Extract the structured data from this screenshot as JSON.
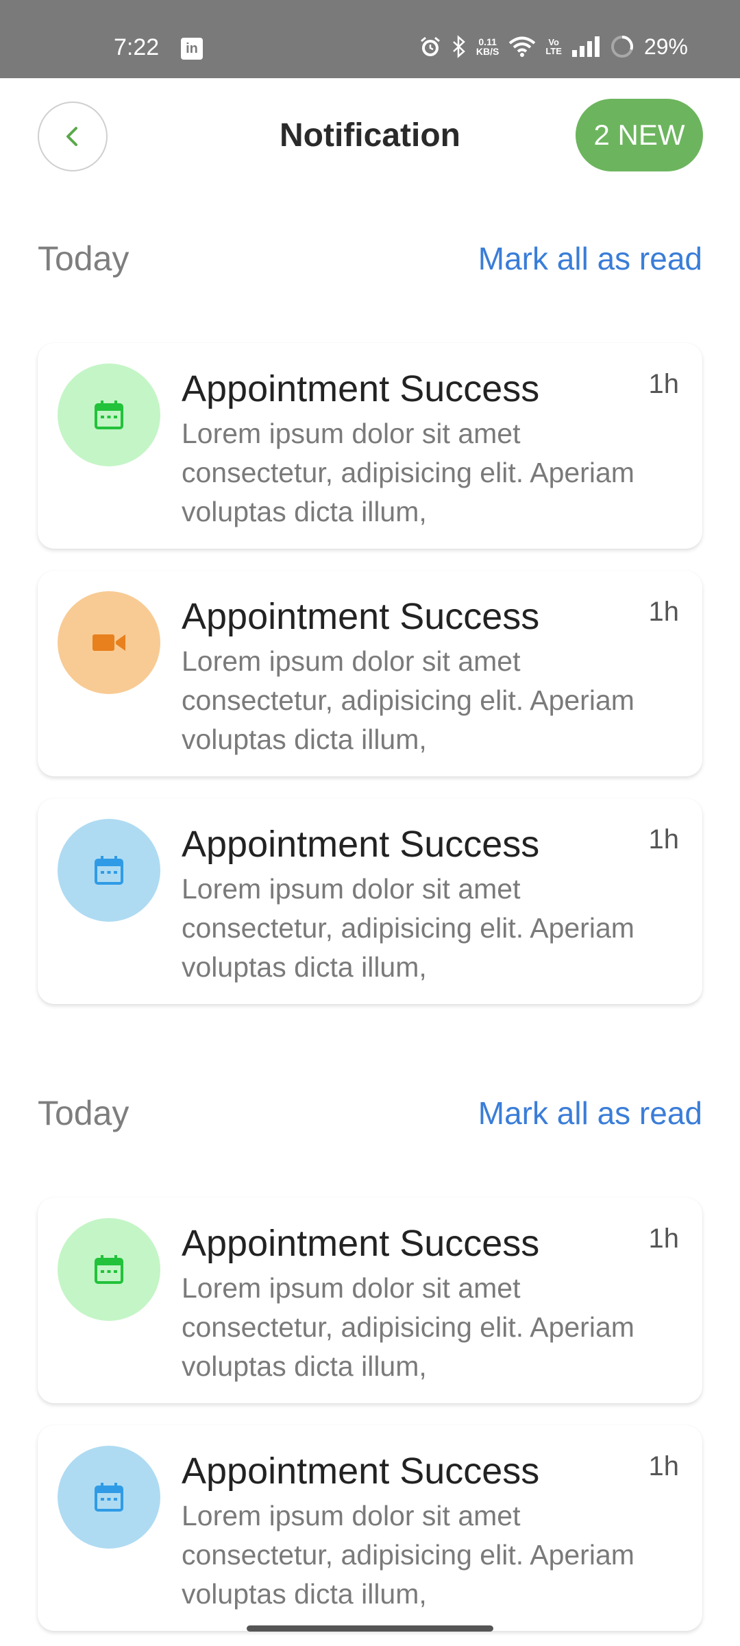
{
  "status_bar": {
    "time": "7:22",
    "app_icon": "LinkedIn",
    "net_speed_value": "0.11",
    "net_speed_unit": "KB/S",
    "volte_top": "Vo",
    "volte_bottom": "LTE",
    "battery": "29%"
  },
  "header": {
    "title": "Notification",
    "new_badge": "2 NEW",
    "accent": "#6cb55e"
  },
  "sections": [
    {
      "title": "Today",
      "action": "Mark all as read",
      "items": [
        {
          "icon": "calendar-icon",
          "icon_color": "#22c23a",
          "bg": "#c4f5c6",
          "title": "Appointment Success",
          "time": "1h",
          "body": "Lorem ipsum dolor sit amet consectetur, adipisicing elit. Aperiam voluptas dicta illum,"
        },
        {
          "icon": "video-icon",
          "icon_color": "#e8801e",
          "bg": "#f8cb94",
          "title": "Appointment Success",
          "time": "1h",
          "body": "Lorem ipsum dolor sit amet consectetur, adipisicing elit. Aperiam voluptas dicta illum,"
        },
        {
          "icon": "calendar-icon",
          "icon_color": "#2f9be6",
          "bg": "#aedbf2",
          "title": "Appointment Success",
          "time": "1h",
          "body": "Lorem ipsum dolor sit amet consectetur, adipisicing elit. Aperiam voluptas dicta illum,"
        }
      ]
    },
    {
      "title": "Today",
      "action": "Mark all as read",
      "items": [
        {
          "icon": "calendar-icon",
          "icon_color": "#22c23a",
          "bg": "#c4f5c6",
          "title": "Appointment Success",
          "time": "1h",
          "body": "Lorem ipsum dolor sit amet consectetur, adipisicing elit. Aperiam voluptas dicta illum,"
        },
        {
          "icon": "calendar-icon",
          "icon_color": "#2f9be6",
          "bg": "#aedbf2",
          "title": "Appointment Success",
          "time": "1h",
          "body": "Lorem ipsum dolor sit amet consectetur, adipisicing elit. Aperiam voluptas dicta illum,"
        }
      ]
    }
  ]
}
